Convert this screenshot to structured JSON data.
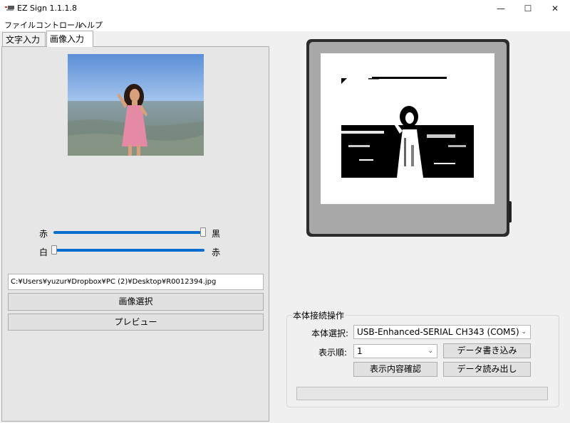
{
  "window": {
    "title": "EZ Sign 1.1.1.8",
    "controls": {
      "minimize": "—",
      "maximize": "☐",
      "close": "✕"
    }
  },
  "menu": [
    "ファイル",
    "コントロール",
    "ヘルプ"
  ],
  "tabs": [
    {
      "label": "文字入力",
      "active": false
    },
    {
      "label": "画像入力",
      "active": true
    }
  ],
  "image_panel": {
    "slider1": {
      "left_label": "赤",
      "right_label": "黒",
      "value": 1.0
    },
    "slider2": {
      "left_label": "白",
      "right_label": "赤",
      "value": 0.0
    },
    "file_path": "C:¥Users¥yuzur¥Dropbox¥PC (2)¥Desktop¥R0012394.jpg",
    "select_image_button": "画像選択",
    "preview_button": "プレビュー"
  },
  "connection": {
    "group_title": "本体接続操作",
    "device_label": "本体選択:",
    "device_value": "USB-Enhanced-SERIAL CH343 (COM5)",
    "order_label": "表示順:",
    "order_value": "1",
    "write_button": "データ書き込み",
    "check_button": "表示内容確認",
    "read_button": "データ読み出し",
    "progress": 0
  },
  "colors": {
    "accent": "#0a6ecf",
    "device_frame": "#3a3a3a",
    "device_bezel": "#a8a8a8"
  }
}
